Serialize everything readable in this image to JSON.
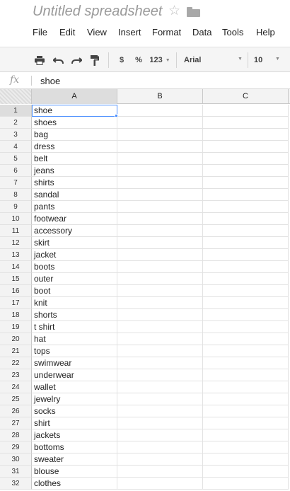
{
  "title": {
    "doc_title": "Untitled spreadsheet",
    "star_icon": "star-outline-icon",
    "folder_icon": "folder-icon"
  },
  "menu": [
    {
      "label": "File"
    },
    {
      "label": "Edit"
    },
    {
      "label": "View"
    },
    {
      "label": "Insert"
    },
    {
      "label": "Format"
    },
    {
      "label": "Data"
    },
    {
      "label": "Tools"
    },
    {
      "label": "Help"
    }
  ],
  "toolbar": {
    "print_icon": "print-icon",
    "undo_icon": "undo-icon",
    "redo_icon": "redo-icon",
    "paint_format_icon": "paint-format-icon",
    "currency_label": "$",
    "percent_label": "%",
    "number_format_label": "123",
    "font_name": "Arial",
    "font_size": "10"
  },
  "formula_bar": {
    "fx_label": "fx",
    "value": "shoe"
  },
  "grid": {
    "columns": [
      "A",
      "B",
      "C"
    ],
    "active_column": "A",
    "selected_cell": "A1",
    "rows": [
      {
        "num": "1",
        "a": "shoe"
      },
      {
        "num": "2",
        "a": "shoes"
      },
      {
        "num": "3",
        "a": "bag"
      },
      {
        "num": "4",
        "a": "dress"
      },
      {
        "num": "5",
        "a": "belt"
      },
      {
        "num": "6",
        "a": "jeans"
      },
      {
        "num": "7",
        "a": "shirts"
      },
      {
        "num": "8",
        "a": "sandal"
      },
      {
        "num": "9",
        "a": "pants"
      },
      {
        "num": "10",
        "a": "footwear"
      },
      {
        "num": "11",
        "a": "accessory"
      },
      {
        "num": "12",
        "a": "skirt"
      },
      {
        "num": "13",
        "a": "jacket"
      },
      {
        "num": "14",
        "a": "boots"
      },
      {
        "num": "15",
        "a": "outer"
      },
      {
        "num": "16",
        "a": "boot"
      },
      {
        "num": "17",
        "a": "knit"
      },
      {
        "num": "18",
        "a": "shorts"
      },
      {
        "num": "19",
        "a": "t shirt"
      },
      {
        "num": "20",
        "a": "hat"
      },
      {
        "num": "21",
        "a": "tops"
      },
      {
        "num": "22",
        "a": "swimwear"
      },
      {
        "num": "23",
        "a": "underwear"
      },
      {
        "num": "24",
        "a": "wallet"
      },
      {
        "num": "25",
        "a": "jewelry"
      },
      {
        "num": "26",
        "a": "socks"
      },
      {
        "num": "27",
        "a": "shirt"
      },
      {
        "num": "28",
        "a": "jackets"
      },
      {
        "num": "29",
        "a": "bottoms"
      },
      {
        "num": "30",
        "a": "sweater"
      },
      {
        "num": "31",
        "a": "blouse"
      },
      {
        "num": "32",
        "a": "clothes"
      }
    ]
  },
  "colors": {
    "selection": "#4d90fe",
    "header_bg": "#f3f3f3",
    "active_header_bg": "#dddddd",
    "toolbar_bg": "#f5f5f5"
  }
}
